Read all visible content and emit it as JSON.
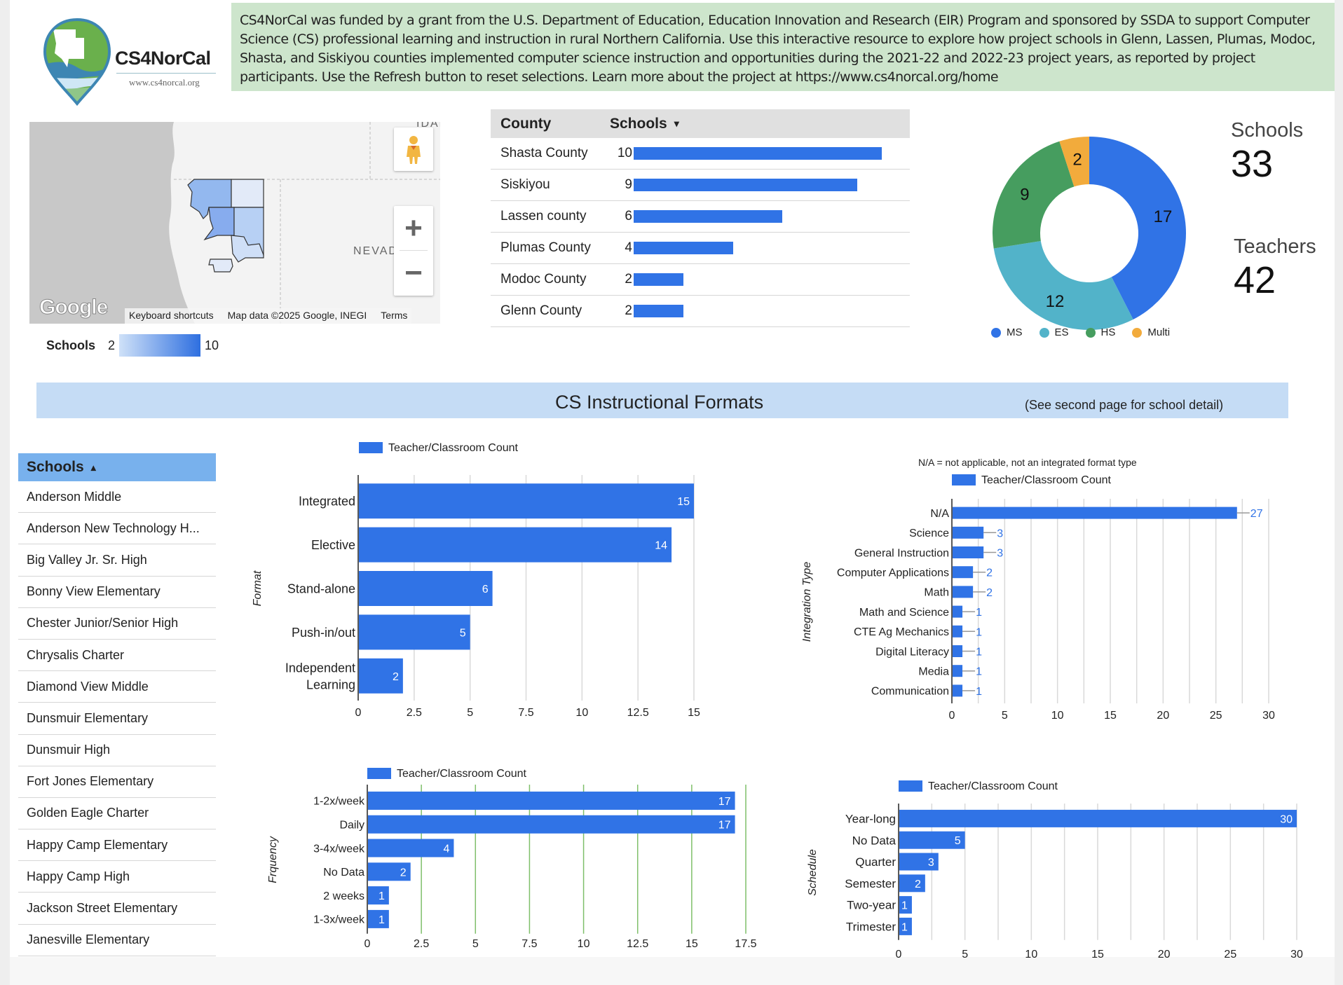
{
  "header": {
    "logo_brand": "CS4NorCal",
    "logo_url": "www.cs4norcal.org",
    "intro_text": "CS4NorCal was funded by a grant from the U.S. Department of Education, Education Innovation and Research (EIR) Program and sponsored by SSDA to support Computer Science (CS) professional learning and instruction in rural Northern California. Use this interactive resource to explore how project schools in Glenn, Lassen, Plumas, Modoc, Shasta, and Siskiyou counties implemented computer science instruction and opportunities during the 2021-22 and 2022-23 project years, as reported by project participants. Use the Refresh button to reset selections. Learn more about the project at https://www.cs4norcal.org/home"
  },
  "map": {
    "label_nevada": "NEVADA",
    "label_idaho": "IDAH",
    "google_logo": "Google",
    "attribution": {
      "shortcuts": "Keyboard shortcuts",
      "data": "Map data ©2025 Google, INEGI",
      "terms": "Terms"
    },
    "zoom_in": "+",
    "zoom_out": "−",
    "pegman_icon": "pegman-icon",
    "legend": {
      "title": "Schools",
      "min": "2",
      "max": "10",
      "color_low": "#cfe1f8",
      "color_high": "#2e6fe0"
    }
  },
  "county_table": {
    "headers": {
      "county": "County",
      "schools": "Schools",
      "sort_icon": "▾"
    },
    "max": 10,
    "rows": [
      {
        "county": "Shasta County",
        "schools": 10
      },
      {
        "county": "Siskiyou",
        "schools": 9
      },
      {
        "county": "Lassen county",
        "schools": 6
      },
      {
        "county": "Plumas County",
        "schools": 4
      },
      {
        "county": "Modoc County",
        "schools": 2
      },
      {
        "county": "Glenn County",
        "schools": 2
      }
    ]
  },
  "scorecards": {
    "schools": {
      "label": "Schools",
      "value": "33"
    },
    "teachers": {
      "label": "Teachers",
      "value": "42"
    }
  },
  "banner": {
    "title": "CS Instructional Formats",
    "note": "(See second page for school detail)"
  },
  "schools_list": {
    "header": "Schools",
    "sort_icon": "▴",
    "items": [
      "Anderson Middle",
      "Anderson New Technology H...",
      "Big Valley Jr. Sr. High",
      "Bonny View Elementary",
      "Chester Junior/Senior High",
      "Chrysalis Charter",
      "Diamond View Middle",
      "Dunsmuir Elementary",
      "Dunsmuir High",
      "Fort Jones Elementary",
      "Golden Eagle Charter",
      "Happy Camp Elementary",
      "Happy Camp High",
      "Jackson Street Elementary",
      "Janesville Elementary"
    ]
  },
  "colors": {
    "bar": "#3073e6",
    "ms": "#3073e6",
    "es": "#52b3c9",
    "hs": "#469d5f",
    "multi": "#f2ab3c",
    "grid": "#d9d9d9",
    "grid_green": "#7fbf6a"
  },
  "chart_data": [
    {
      "id": "school-level-donut",
      "type": "pie",
      "donut": true,
      "title": "",
      "categories": [
        "MS",
        "ES",
        "HS",
        "Multi"
      ],
      "values": [
        17,
        12,
        9,
        2
      ],
      "colors": [
        "#3073e6",
        "#52b3c9",
        "#469d5f",
        "#f2ab3c"
      ],
      "legend": "bottom"
    },
    {
      "id": "format-chart",
      "type": "bar",
      "orientation": "horizontal",
      "legend": "top",
      "series_name": "Teacher/Classroom Count",
      "ylabel": "Format",
      "xlabel": "",
      "categories": [
        "Integrated",
        "Elective",
        "Stand-alone",
        "Push-in/out",
        "Independent Learning"
      ],
      "values": [
        15,
        14,
        6,
        5,
        2
      ],
      "xlim": [
        0,
        15
      ],
      "ticks": [
        "0",
        "2.5",
        "5",
        "7.5",
        "10",
        "12.5",
        "15"
      ],
      "grid": true,
      "label_position": "inside"
    },
    {
      "id": "integration-chart",
      "type": "bar",
      "orientation": "horizontal",
      "legend": "top",
      "subtitle": "N/A = not applicable, not an integrated format type",
      "series_name": "Teacher/Classroom Count",
      "ylabel": "Integration Type",
      "xlabel": "",
      "categories": [
        "N/A",
        "Science",
        "General Instruction",
        "Computer Applications",
        "Math",
        "Math and Science",
        "CTE Ag Mechanics",
        "Digital Literacy",
        "Media",
        "Communication"
      ],
      "values": [
        27,
        3,
        3,
        2,
        2,
        1,
        1,
        1,
        1,
        1
      ],
      "xlim": [
        0,
        30
      ],
      "ticks": [
        "0",
        "5",
        "10",
        "15",
        "20",
        "25",
        "30"
      ],
      "grid": true,
      "label_position": "outside"
    },
    {
      "id": "frequency-chart",
      "type": "bar",
      "orientation": "horizontal",
      "legend": "top",
      "series_name": "Teacher/Classroom Count",
      "ylabel": "Frquency",
      "xlabel": "",
      "categories": [
        "1-2x/week",
        "Daily",
        "3-4x/week",
        "No Data",
        "2 weeks",
        "1-3x/week"
      ],
      "values": [
        17,
        17,
        4,
        2,
        1,
        1
      ],
      "xlim": [
        0,
        17.5
      ],
      "ticks": [
        "0",
        "2.5",
        "5",
        "7.5",
        "10",
        "12.5",
        "15",
        "17.5"
      ],
      "grid": true,
      "label_position": "inside"
    },
    {
      "id": "schedule-chart",
      "type": "bar",
      "orientation": "horizontal",
      "legend": "top",
      "series_name": "Teacher/Classroom Count",
      "ylabel": "Schedule",
      "xlabel": "",
      "categories": [
        "Year-long",
        "No Data",
        "Quarter",
        "Semester",
        "Two-year",
        "Trimester"
      ],
      "values": [
        30,
        5,
        3,
        2,
        1,
        1
      ],
      "xlim": [
        0,
        30
      ],
      "ticks": [
        "0",
        "5",
        "10",
        "15",
        "20",
        "25",
        "30"
      ],
      "grid": true,
      "label_position": "inside"
    }
  ]
}
